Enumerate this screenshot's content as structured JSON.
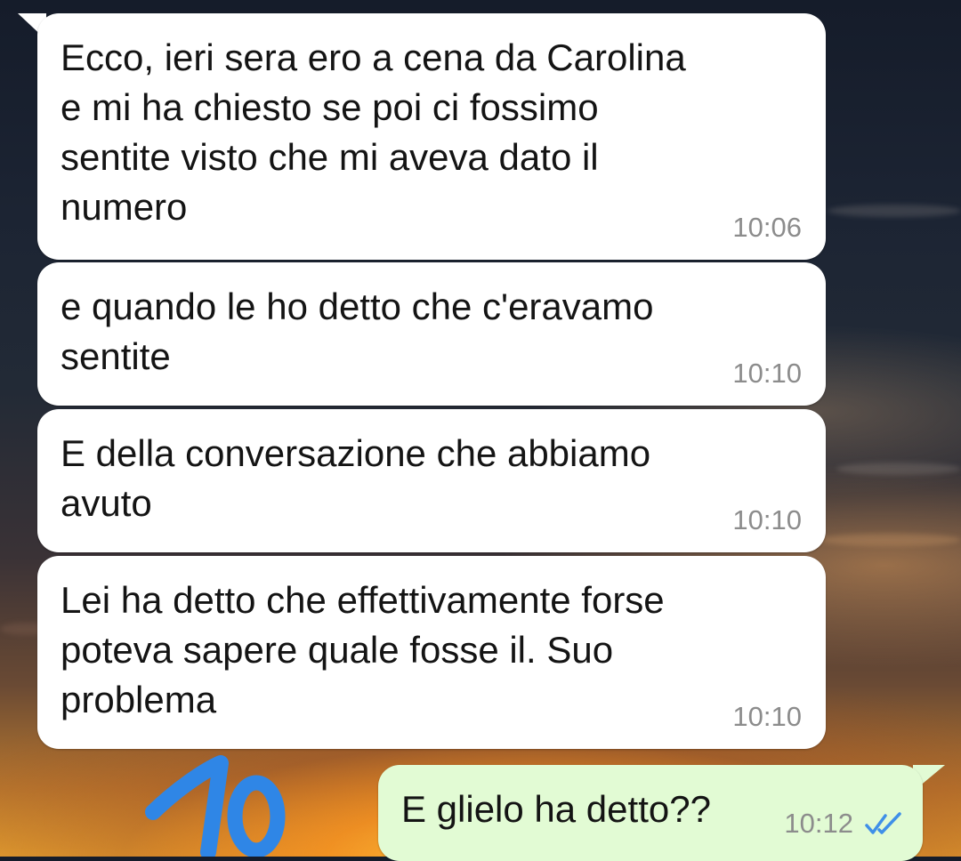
{
  "messages": [
    {
      "direction": "incoming",
      "text": "Ecco, ieri sera ero a cena da Carolina e mi ha chiesto se poi ci fossimo sentite visto che mi aveva dato il numero",
      "time": "10:06"
    },
    {
      "direction": "incoming",
      "text": "e quando le ho detto che c'eravamo sentite",
      "time": "10:10"
    },
    {
      "direction": "incoming",
      "text": "E della conversazione che abbiamo avuto",
      "time": "10:10"
    },
    {
      "direction": "incoming",
      "text": "Lei ha detto che effettivamente forse poteva sapere quale fosse il. Suo problema",
      "time": "10:10"
    },
    {
      "direction": "outgoing",
      "text": "E glielo ha detto??",
      "time": "10:12",
      "status_icon": "double-check-read-icon"
    }
  ],
  "annotation": {
    "text": "10",
    "color": "#2f86e6"
  },
  "colors": {
    "incoming_bubble": "#ffffff",
    "outgoing_bubble": "#e2fbd4",
    "timestamp": "#8c8c8c",
    "read_ticks": "#3f8fe8"
  }
}
